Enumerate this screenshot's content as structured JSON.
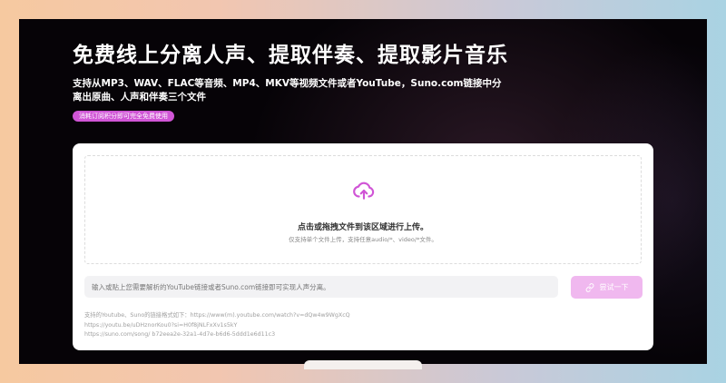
{
  "hero": {
    "headline": "免费线上分离人声、提取伴奏、提取影片音乐",
    "subtitle": "支持从MP3、WAV、FLAC等音频、MP4、MKV等视频文件或者YouTube，Suno.com链接中分离出原曲、人声和伴奏三个文件",
    "badge": "消耗订阅积分即可完全免费使用"
  },
  "upload": {
    "icon": "cloud-upload-icon",
    "title": "点击或拖拽文件到该区域进行上传。",
    "hint": "仅支持单个文件上传，支持任意audio/*、video/*文件。"
  },
  "url_input": {
    "value": "",
    "placeholder": "输入或贴上您需要解析的YouTube链接或者Suno.com链接即可实现人声分离。"
  },
  "try_button": {
    "icon": "link-icon",
    "label": "尝试一下"
  },
  "examples": {
    "lines": [
      "支持的Youtube、Suno的链接格式如下：https://www(m).youtube.com/watch?v=dQw4w9WgXcQ",
      "https://youtu.be/uDHznorKou0?si=H0f8jNLFxXv1s5kY",
      "https://suno.com/song/ b72eea2e-32a1-4d7e-b6d6-5ddd1e6d11c3"
    ]
  },
  "colors": {
    "accent": "#d055d6",
    "button_bg": "#f0b8ef",
    "frame_bg": "#060307"
  }
}
